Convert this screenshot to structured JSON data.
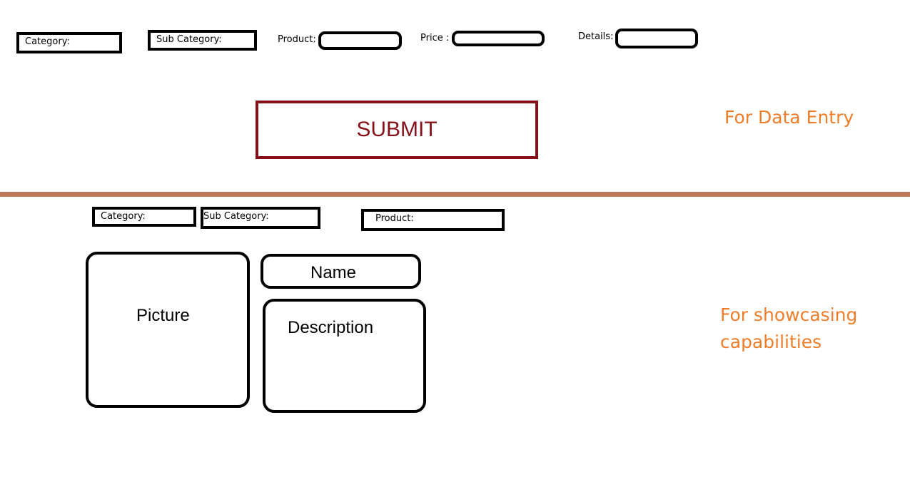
{
  "data_entry": {
    "category_label": "Category:",
    "sub_category_label": "Sub Category:",
    "product_label": "Product:",
    "price_label": "Price :",
    "details_label": "Details:",
    "submit_label": "SUBMIT",
    "annotation": "For Data Entry"
  },
  "showcase": {
    "category_label": "Category:",
    "sub_category_label": "Sub Category:",
    "product_label": "Product:",
    "picture_label": "Picture",
    "name_label": "Name",
    "description_label": "Description",
    "annotation_line1": "For showcasing",
    "annotation_line2": "capabilities"
  },
  "colors": {
    "submit": "#85101a",
    "annotation": "#f07d2a",
    "divider": "#c0785a"
  }
}
